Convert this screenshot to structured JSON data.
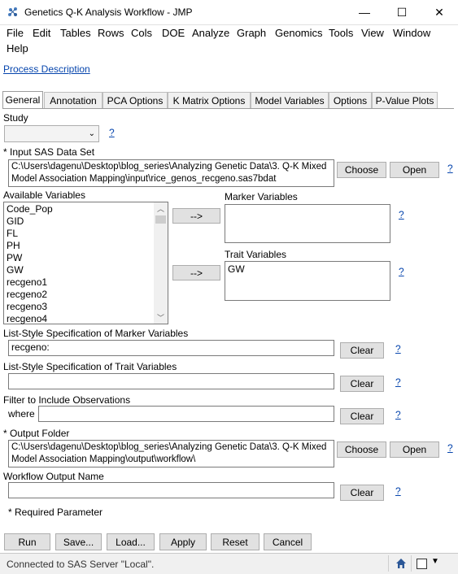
{
  "window": {
    "title": "Genetics Q-K Analysis Workflow - JMP",
    "minimize": "—",
    "maximize": "☐",
    "close": "✕"
  },
  "menu": [
    "File",
    "Edit",
    "Tables",
    "Rows",
    "Cols",
    "DOE",
    "Analyze",
    "Graph",
    "Genomics",
    "Tools",
    "View",
    "Window",
    "Help"
  ],
  "process_link": "Process Description",
  "tabs": [
    "General",
    "Annotation",
    "PCA Options",
    "K Matrix Options",
    "Model Variables",
    "Options",
    "P-Value Plots"
  ],
  "study": {
    "label": "Study",
    "value": "",
    "help": "?"
  },
  "input": {
    "label": "* Input SAS Data Set",
    "path": "C:\\Users\\dagenu\\Desktop\\blog_series\\Analyzing Genetic Data\\3. Q-K Mixed Model Association Mapping\\input\\rice_genos_recgeno.sas7bdat",
    "choose": "Choose",
    "open": "Open",
    "help": "?"
  },
  "available": {
    "label": "Available Variables",
    "items": [
      "Code_Pop",
      "GID",
      "FL",
      "PH",
      "PW",
      "GW",
      "recgeno1",
      "recgeno2",
      "recgeno3",
      "recgeno4"
    ]
  },
  "arrow_button": "-->",
  "marker": {
    "label": "Marker Variables",
    "help": "?",
    "items": []
  },
  "trait": {
    "label": "Trait Variables",
    "help": "?",
    "items": [
      "GW"
    ]
  },
  "list_marker": {
    "label": "List-Style Specification of Marker Variables",
    "value": "recgeno:",
    "clear": "Clear",
    "help": "?"
  },
  "list_trait": {
    "label": "List-Style Specification of Trait Variables",
    "value": "",
    "clear": "Clear",
    "help": "?"
  },
  "filter": {
    "label": "Filter to Include Observations",
    "where": "where",
    "value": "",
    "clear": "Clear",
    "help": "?"
  },
  "output": {
    "label": "* Output Folder",
    "path": "C:\\Users\\dagenu\\Desktop\\blog_series\\Analyzing Genetic Data\\3. Q-K Mixed Model Association Mapping\\output\\workflow\\",
    "choose": "Choose",
    "open": "Open",
    "help": "?"
  },
  "workflow_name": {
    "label": "Workflow Output Name",
    "value": "",
    "clear": "Clear",
    "help": "?"
  },
  "required_note": "* Required Parameter",
  "bottom_buttons": [
    "Run",
    "Save...",
    "Load...",
    "Apply",
    "Reset",
    "Cancel"
  ],
  "status": "Connected to SAS Server \"Local\"."
}
